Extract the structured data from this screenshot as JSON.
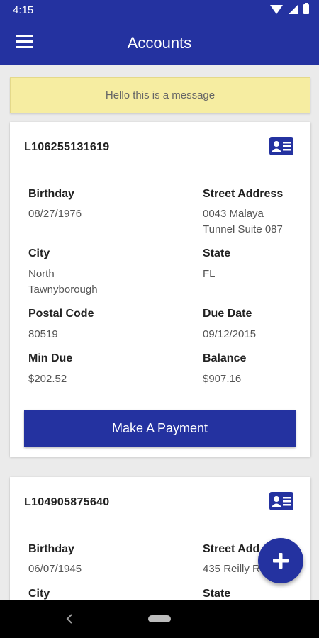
{
  "status_bar": {
    "time": "4:15"
  },
  "app_bar": {
    "title": "Accounts"
  },
  "message": "Hello this is a message",
  "accounts": [
    {
      "account_number": "L106255131619",
      "fields": {
        "birthday": {
          "label": "Birthday",
          "value": "08/27/1976"
        },
        "street_address": {
          "label": "Street Address",
          "line1": "0043 Malaya",
          "line2": "Tunnel Suite 087"
        },
        "city": {
          "label": "City",
          "line1": "North",
          "line2": "Tawnyborough"
        },
        "state": {
          "label": "State",
          "value": "FL"
        },
        "postal_code": {
          "label": "Postal Code",
          "value": "80519"
        },
        "due_date": {
          "label": "Due Date",
          "value": "09/12/2015"
        },
        "min_due": {
          "label": "Min Due",
          "value": "$202.52"
        },
        "balance": {
          "label": "Balance",
          "value": "$907.16"
        }
      },
      "payment_button_label": "Make A Payment"
    },
    {
      "account_number": "L104905875640",
      "fields": {
        "birthday": {
          "label": "Birthday",
          "value": "06/07/1945"
        },
        "street_address": {
          "label": "Street Add",
          "line1": "435 Reilly R"
        },
        "city": {
          "label": "City"
        },
        "state": {
          "label": "State"
        }
      }
    }
  ],
  "icons": {
    "menu": "hamburger-menu-icon",
    "card": "id-card-icon",
    "fab": "plus-icon",
    "back": "back-chevron-icon",
    "home": "home-pill-icon"
  },
  "colors": {
    "primary": "#2432a0",
    "message_bg": "#f6eda1",
    "background": "#ebebeb",
    "card": "#ffffff"
  }
}
